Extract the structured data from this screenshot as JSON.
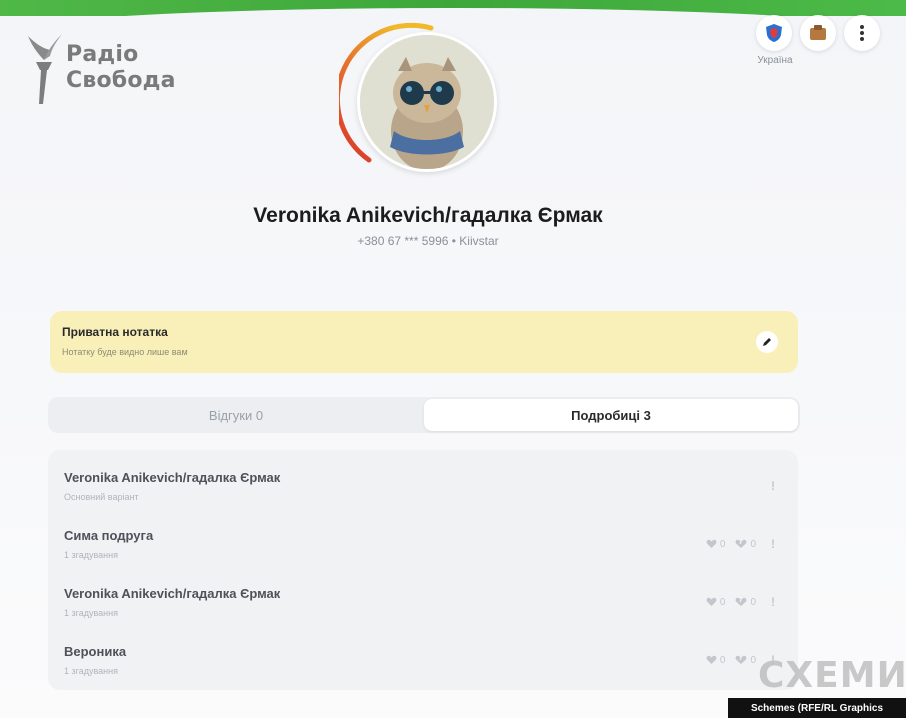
{
  "header": {
    "brand_line1": "Радіо",
    "brand_line2": "Свобода",
    "country_label": "Україна",
    "accent_color": "#43b040"
  },
  "profile": {
    "name": "Veronika Anikevich/гадалка Єрмак",
    "phone": "+380 67 *** 5996 • Kiivstar",
    "rating_ring_colors": [
      "#d9342b",
      "#f0b92c"
    ]
  },
  "note": {
    "title": "Приватна нотатка",
    "subtitle": "Нотатку буде видно лише вам"
  },
  "tabs": [
    {
      "label": "Відгуки 0",
      "active": false
    },
    {
      "label": "Подробиці 3",
      "active": true
    }
  ],
  "entries": [
    {
      "name": "Veronika Anikevich/гадалка Єрмак",
      "sub": "Основний варіант",
      "likes": null,
      "dislikes": null,
      "report": "!"
    },
    {
      "name": "Сима подруга",
      "sub": "1 згадування",
      "likes": "0",
      "dislikes": "0",
      "report": "!"
    },
    {
      "name": "Veronika Anikevich/гадалка Єрмак",
      "sub": "1 згадування",
      "likes": "0",
      "dislikes": "0",
      "report": "!"
    },
    {
      "name": "Вероника",
      "sub": "1 згадування",
      "likes": "0",
      "dislikes": "0",
      "report": "!"
    }
  ],
  "overlay": {
    "watermark": "СХЕМИ",
    "credit": "Schemes (RFE/RL Graphics"
  }
}
